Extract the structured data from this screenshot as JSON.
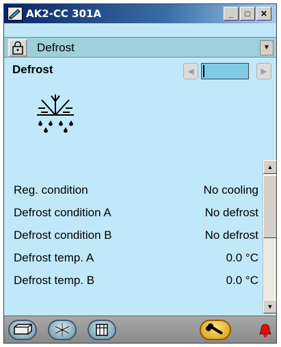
{
  "window": {
    "title": "AK2-CC 301A"
  },
  "titlebar_buttons": {
    "minimize": "_",
    "maximize": "□",
    "close": "✕"
  },
  "dropdown": {
    "selected": "Defrost"
  },
  "section": {
    "title": "Defrost"
  },
  "rows": [
    {
      "label": "Reg. condition",
      "value": "No cooling"
    },
    {
      "label": "Defrost condition A",
      "value": "No defrost"
    },
    {
      "label": "Defrost condition B",
      "value": "No defrost"
    },
    {
      "label": "Defrost temp. A",
      "value": "0.0 °C"
    },
    {
      "label": "Defrost temp. B",
      "value": "0.0 °C"
    }
  ],
  "icons": {
    "app": "pen-icon",
    "lock": "lock-icon",
    "snow": "snowflake-defrost-icon",
    "footer_1": "display-case-icon",
    "footer_2": "snowflake-icon",
    "footer_3": "grid-icon",
    "wrench": "wrench-icon",
    "alarm": "alarm-bell-icon"
  },
  "colors": {
    "panel": "#c0e8f8",
    "titlebar": "#0a246a",
    "wrench_button": "#e0a820",
    "alarm": "#e01010"
  }
}
